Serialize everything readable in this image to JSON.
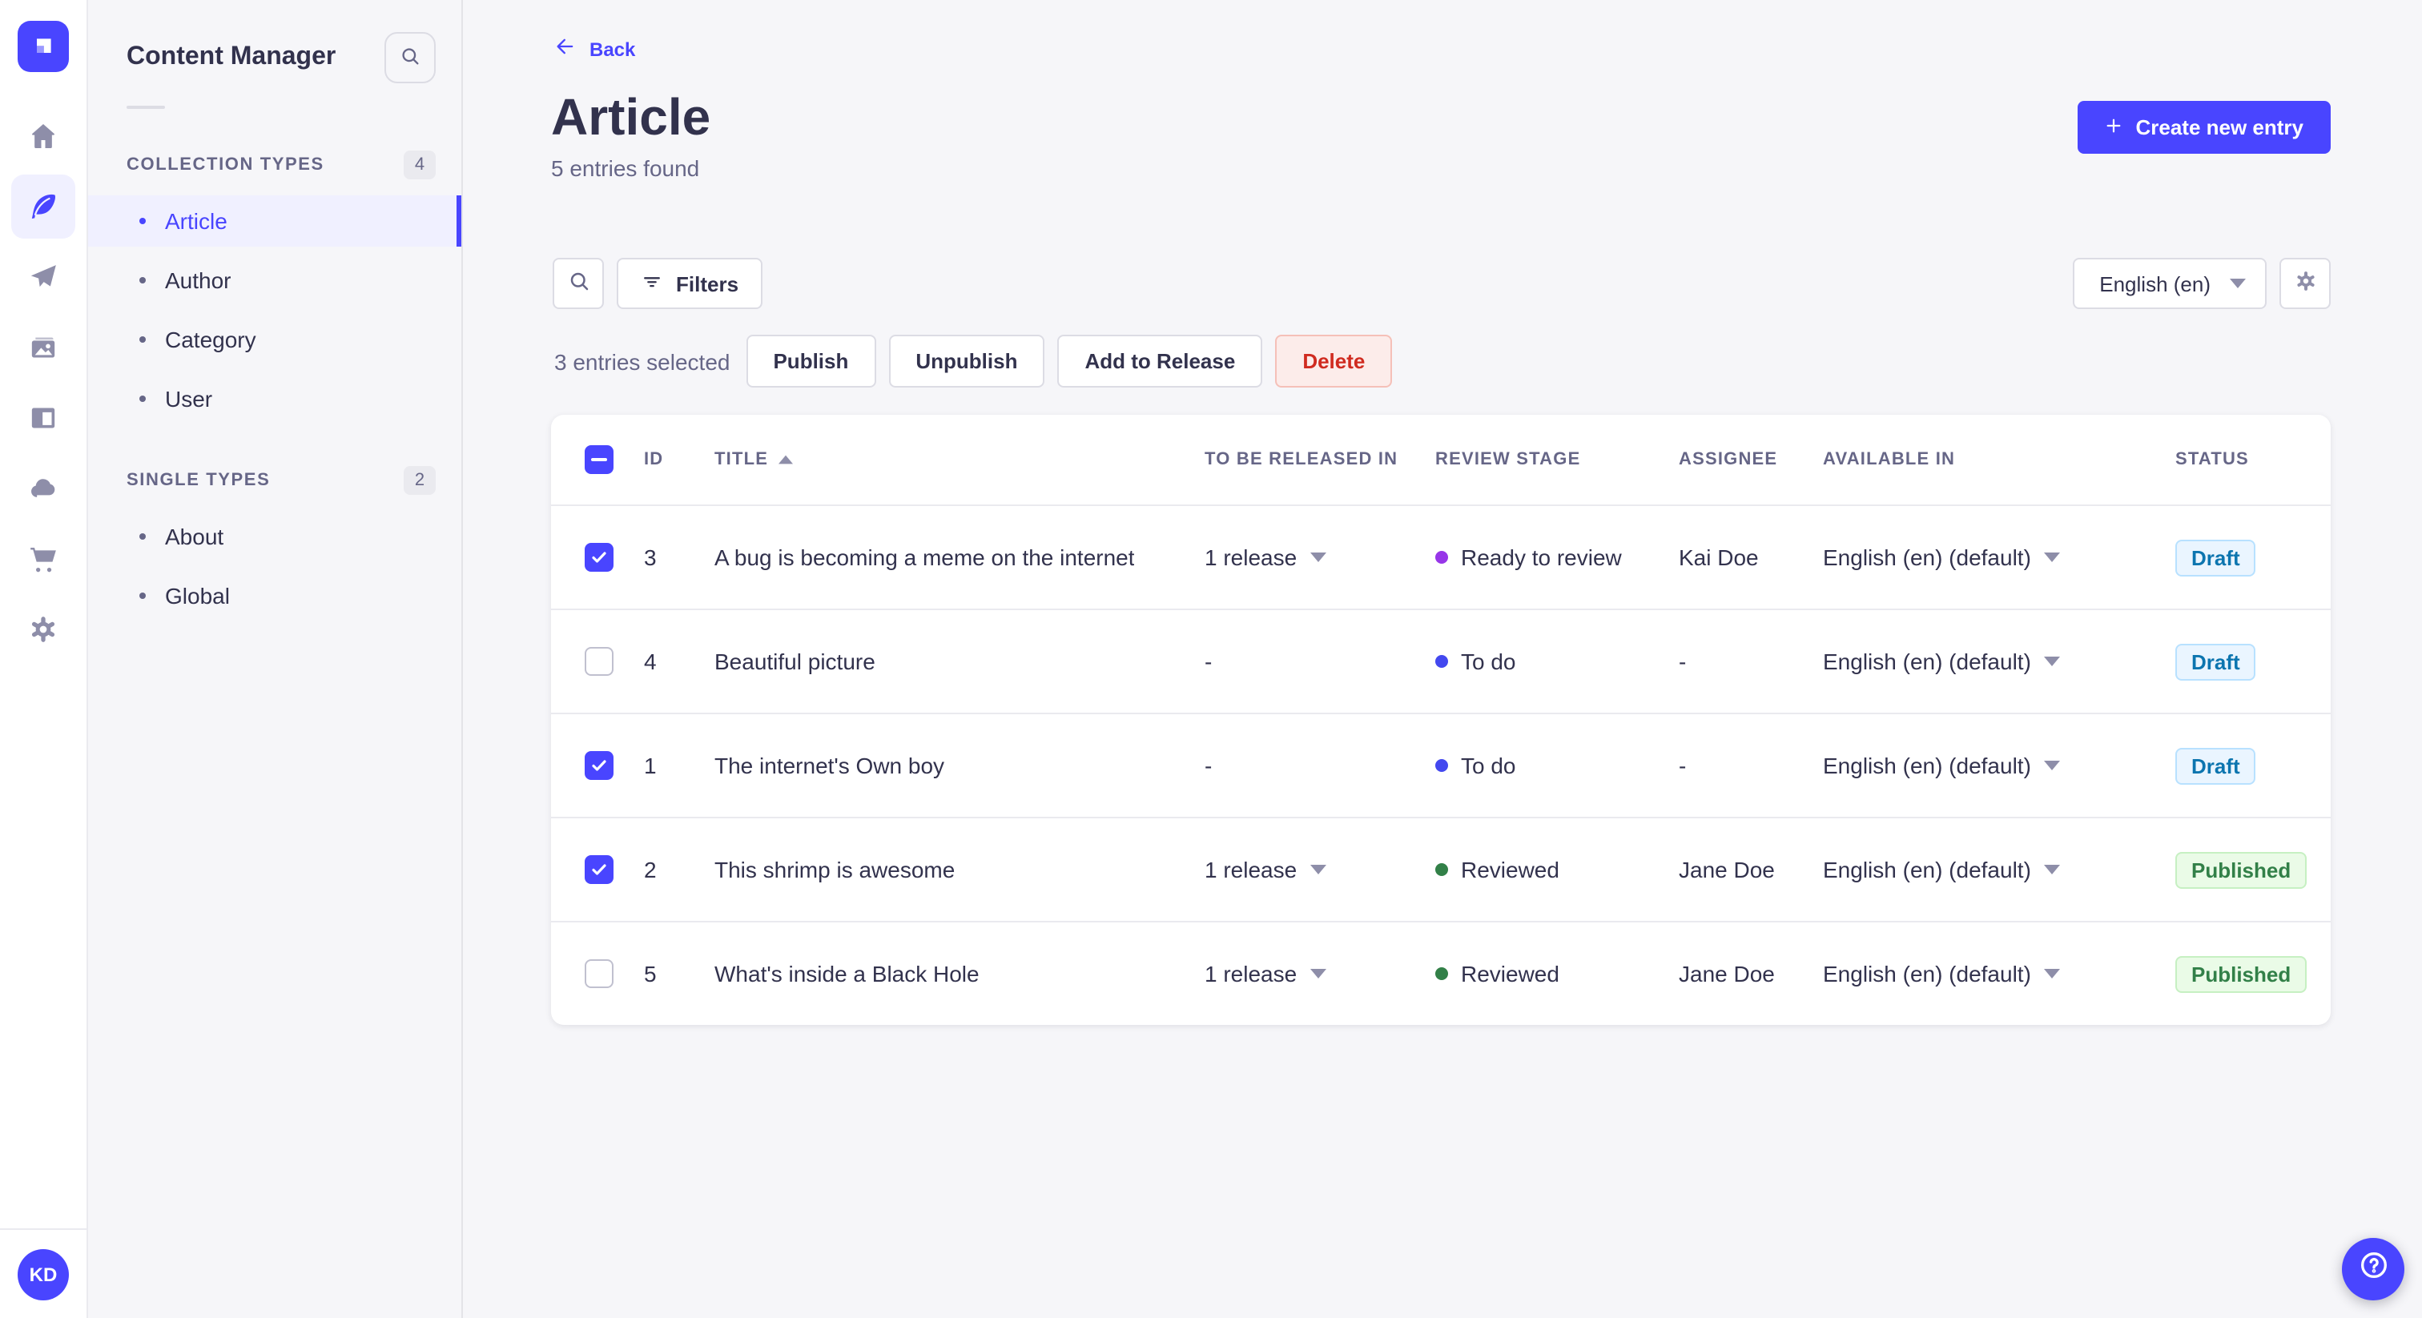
{
  "nav_rail": {
    "icons": [
      "home-icon",
      "content-manager-feather-icon",
      "releases-plane-icon",
      "media-library-icon",
      "content-type-builder-icon",
      "cloud-icon",
      "marketplace-cart-icon",
      "settings-gear-icon"
    ],
    "active_icon": "content-manager-feather-icon",
    "avatar_initials": "KD"
  },
  "sidebar": {
    "title": "Content Manager",
    "search_icon": "search-icon",
    "sections": [
      {
        "label": "COLLECTION TYPES",
        "count": "4",
        "items": [
          {
            "label": "Article",
            "active": true
          },
          {
            "label": "Author",
            "active": false
          },
          {
            "label": "Category",
            "active": false
          },
          {
            "label": "User",
            "active": false
          }
        ]
      },
      {
        "label": "SINGLE TYPES",
        "count": "2",
        "items": [
          {
            "label": "About",
            "active": false
          },
          {
            "label": "Global",
            "active": false
          }
        ]
      }
    ]
  },
  "header": {
    "back_label": "Back",
    "title": "Article",
    "subtitle": "5 entries found",
    "create_button_label": "Create new entry"
  },
  "toolbar": {
    "search_icon": "search-icon",
    "filters_label": "Filters",
    "locale_value": "English (en)",
    "settings_icon": "gear-icon"
  },
  "selection_bar": {
    "selected_text": "3 entries selected",
    "publish_label": "Publish",
    "unpublish_label": "Unpublish",
    "add_to_release_label": "Add to Release",
    "delete_label": "Delete"
  },
  "table": {
    "columns": [
      "ID",
      "TITLE",
      "TO BE RELEASED IN",
      "REVIEW STAGE",
      "ASSIGNEE",
      "AVAILABLE IN",
      "STATUS"
    ],
    "sort": {
      "column": "TITLE",
      "direction": "asc"
    },
    "header_checkbox_state": "indeterminate",
    "rows": [
      {
        "checked": true,
        "id": "3",
        "title": "A bug is becoming a meme on the internet",
        "release": "1 release",
        "stage": "Ready to review",
        "stage_color": "#9736e8",
        "assignee": "Kai Doe",
        "available": "English (en) (default)",
        "status": "Draft"
      },
      {
        "checked": false,
        "id": "4",
        "title": "Beautiful picture",
        "release": "-",
        "stage": "To do",
        "stage_color": "#4348ef",
        "assignee": "-",
        "available": "English (en) (default)",
        "status": "Draft"
      },
      {
        "checked": true,
        "id": "1",
        "title": "The internet's Own boy",
        "release": "-",
        "stage": "To do",
        "stage_color": "#4348ef",
        "assignee": "-",
        "available": "English (en) (default)",
        "status": "Draft"
      },
      {
        "checked": true,
        "id": "2",
        "title": "This shrimp is awesome",
        "release": "1 release",
        "stage": "Reviewed",
        "stage_color": "#328048",
        "assignee": "Jane Doe",
        "available": "English (en) (default)",
        "status": "Published"
      },
      {
        "checked": false,
        "id": "5",
        "title": "What's inside a Black Hole",
        "release": "1 release",
        "stage": "Reviewed",
        "stage_color": "#328048",
        "assignee": "Jane Doe",
        "available": "English (en) (default)",
        "status": "Published"
      }
    ]
  },
  "help": {
    "icon": "question-mark-icon"
  },
  "colors": {
    "accent": "#4945ff",
    "background": "#f6f6f9",
    "active_item_background": "#f0f0ff",
    "status_draft_text": "#0c75af",
    "status_draft_background": "#eaf5ff",
    "status_published_text": "#328048",
    "status_published_background": "#eafbe7",
    "delete_text": "#d02b20",
    "delete_background": "#fcecea"
  }
}
